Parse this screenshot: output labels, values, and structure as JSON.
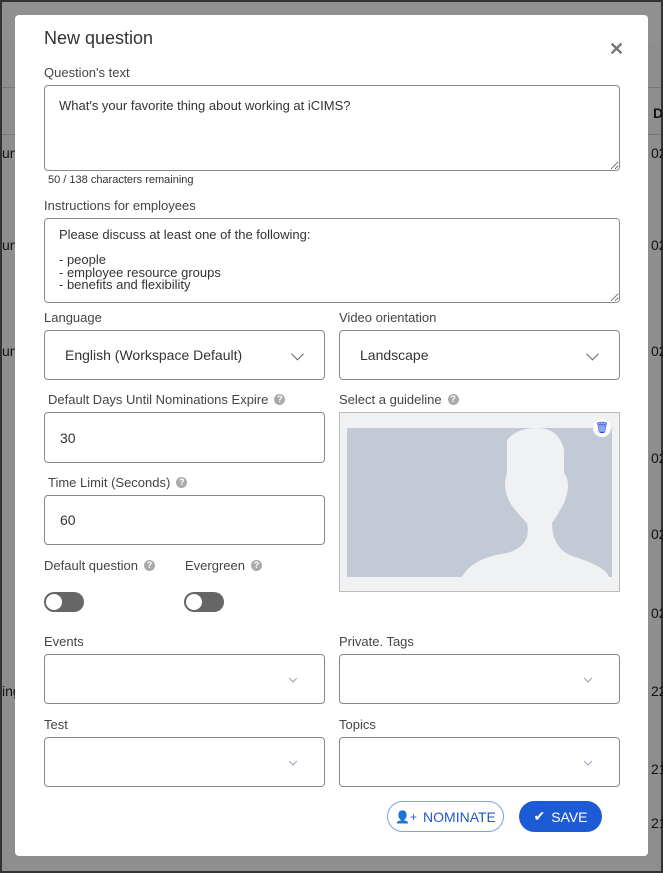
{
  "background": {
    "left_fragments": [
      "uni",
      "uni",
      "uni",
      "ing"
    ],
    "right_fragments": [
      "D",
      "02",
      "02",
      "02",
      "02",
      "02",
      "02",
      "22",
      "21",
      "21"
    ]
  },
  "modal": {
    "title": "New question",
    "question_text": {
      "label": "Question's text",
      "value": "What's your favorite thing about working at iCIMS?",
      "counter": "50 / 138 characters remaining"
    },
    "instructions": {
      "label": "Instructions for employees",
      "value": "Please discuss at least one of the following:\n\n- people\n- employee resource groups\n- benefits and flexibility"
    },
    "language": {
      "label": "Language",
      "value": "English (Workspace Default)"
    },
    "video_orientation": {
      "label": "Video orientation",
      "value": "Landscape"
    },
    "expire_days": {
      "label": "Default Days Until Nominations Expire",
      "value": "30"
    },
    "guideline": {
      "label": "Select a guideline"
    },
    "time_limit": {
      "label": "Time Limit (Seconds)",
      "value": "60"
    },
    "default_question": {
      "label": "Default question",
      "on": false
    },
    "evergreen": {
      "label": "Evergreen",
      "on": false
    },
    "events": {
      "label": "Events",
      "value": ""
    },
    "private_tags": {
      "label": "Private. Tags",
      "value": ""
    },
    "test": {
      "label": "Test",
      "value": ""
    },
    "topics": {
      "label": "Topics",
      "value": ""
    },
    "nominate_label": "NOMINATE",
    "save_label": "SAVE",
    "colors": {
      "primary": "#1d5bd6",
      "toggle_off": "#666666"
    }
  }
}
